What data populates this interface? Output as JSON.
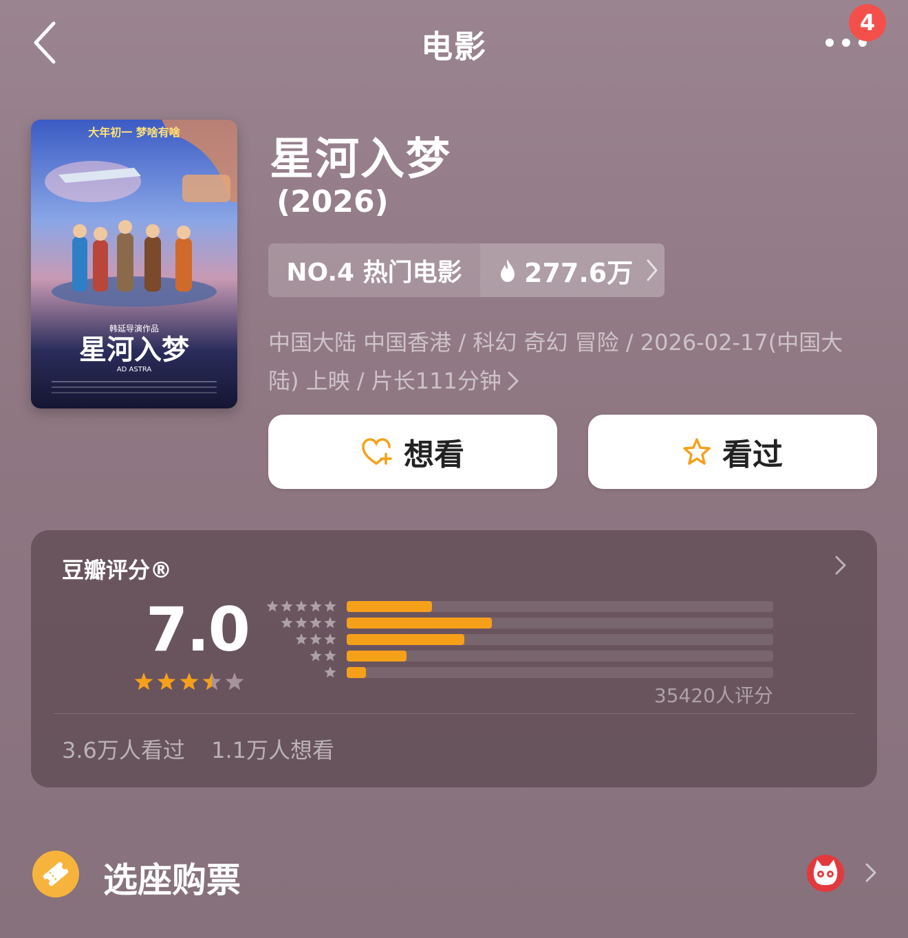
{
  "header": {
    "title": "电影",
    "badge_count": "4",
    "back_icon": "chevron-left-icon",
    "more_icon": "more-dots-icon"
  },
  "movie": {
    "title": "星河入梦",
    "year": "(2026)",
    "rank_label": "NO.4 热门电影",
    "heat_value": "277.6万",
    "meta_line1": "中国大陆 中国香港 / 科幻 奇幻 冒险 / 2026-02-17(中国大",
    "meta_line2": "陆) 上映 / 片长111分钟",
    "poster": {
      "tagline": "大年初一 梦啥有啥",
      "director_credit": "韩延导演作品",
      "title_calligraphy": "星河入梦",
      "english_title": "AD ASTRA"
    }
  },
  "actions": {
    "want_label": "想看",
    "seen_label": "看过"
  },
  "rating": {
    "title": "豆瓣评分®",
    "score": "7.0",
    "stars": 3.5,
    "distribution": [
      {
        "stars": 5,
        "percent": 20
      },
      {
        "stars": 4,
        "percent": 34
      },
      {
        "stars": 3,
        "percent": 27.5
      },
      {
        "stars": 2,
        "percent": 14
      },
      {
        "stars": 1,
        "percent": 4.5
      }
    ],
    "count_text": "35420人评分",
    "seen_count": "3.6万人看过",
    "want_count": "1.1万人想看"
  },
  "ticket": {
    "label": "选座购票",
    "provider_icon": "maoyan-cat-icon"
  },
  "colors": {
    "accent_orange": "#f6a01a",
    "badge_red": "#f4504b",
    "ticket_yellow": "#f7b43c"
  }
}
